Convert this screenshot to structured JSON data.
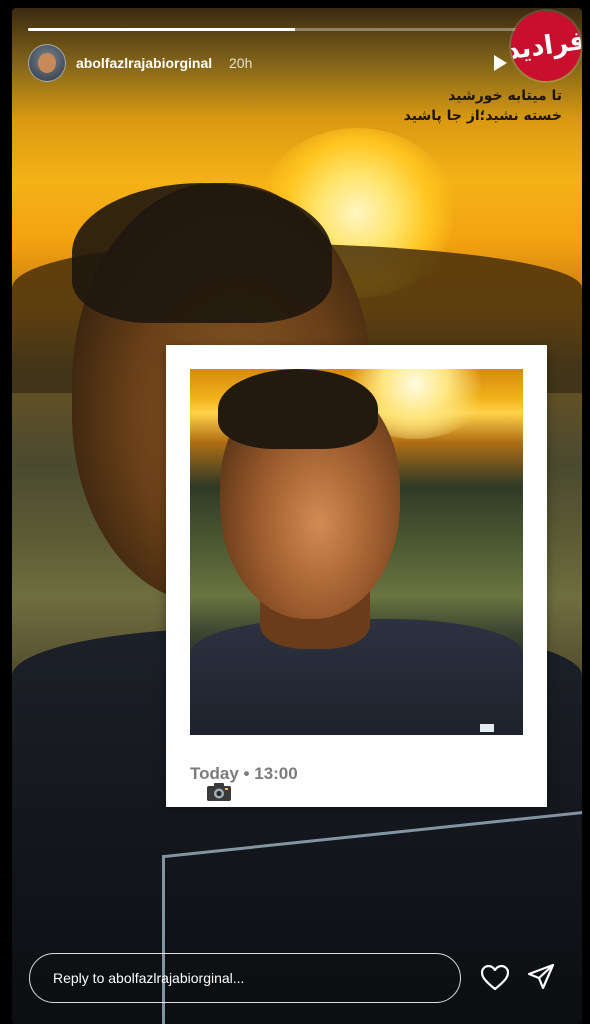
{
  "story": {
    "progress": 0.5,
    "username": "abolfazlrajabiorginal",
    "time_ago": "20h",
    "caption_lines": [
      "تا میتابه خورشید",
      "خسته نشید؛از جا پاشید"
    ]
  },
  "logo": {
    "text": "فرادید"
  },
  "polaroid": {
    "date_label": "Today",
    "separator": "•",
    "time": "13:00"
  },
  "reply": {
    "placeholder": "Reply to abolfazlrajabiorginal..."
  },
  "icons": {
    "play": "play-icon",
    "heart": "heart-icon",
    "send": "send-icon",
    "camera": "camera-icon"
  },
  "colors": {
    "logo_bg": "#c8102e",
    "sun": "#ffd24a"
  }
}
